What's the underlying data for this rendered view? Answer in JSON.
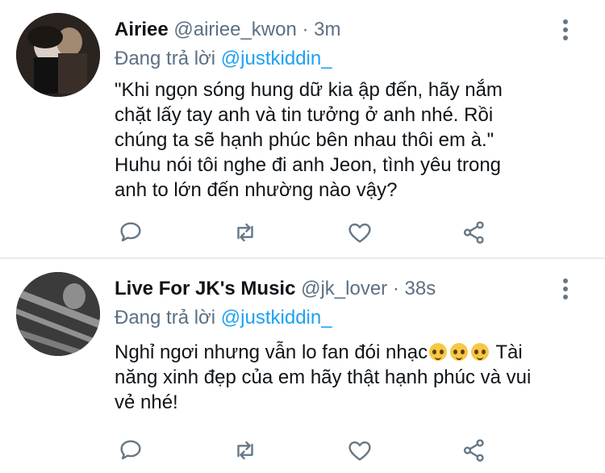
{
  "tweets": [
    {
      "name": "Airiee",
      "handle": "@airiee_kwon",
      "separator": "·",
      "time": "3m",
      "reply_prefix": "Đang trả lời",
      "reply_to": "@justkiddin_",
      "body_lines": [
        "\"Khi ngọn sóng hung dữ kia ập đến, hãy nắm",
        "chặt lấy tay anh và tin tưởng ở anh nhé. Rồi",
        "chúng ta sẽ hạnh phúc bên nhau thôi em à.\"",
        "Huhu nói tôi nghe đi anh Jeon, tình yêu trong",
        "anh to lớn đến nhường nào vậy?"
      ]
    },
    {
      "name": "Live For JK's Music",
      "handle": "@jk_lover",
      "separator": "·",
      "time": "38s",
      "reply_prefix": "Đang trả lời",
      "reply_to": "@justkiddin_",
      "body_lines": [
        "Nghỉ ngơi nhưng vẫn lo fan đói nhạc",
        "Tài",
        "năng xinh đẹp của em hãy thật hạnh phúc và vui",
        "vẻ nhé!"
      ],
      "emoji": "pleading-face-emoji"
    }
  ],
  "icons": {
    "reply": "reply-icon",
    "retweet": "retweet-icon",
    "like": "heart-icon",
    "share": "share-icon",
    "more": "more-vertical-icon"
  },
  "colors": {
    "text": "#0f1419",
    "secondary": "#5b7083",
    "link": "#1da1f2",
    "divider": "#e6ecf0"
  }
}
